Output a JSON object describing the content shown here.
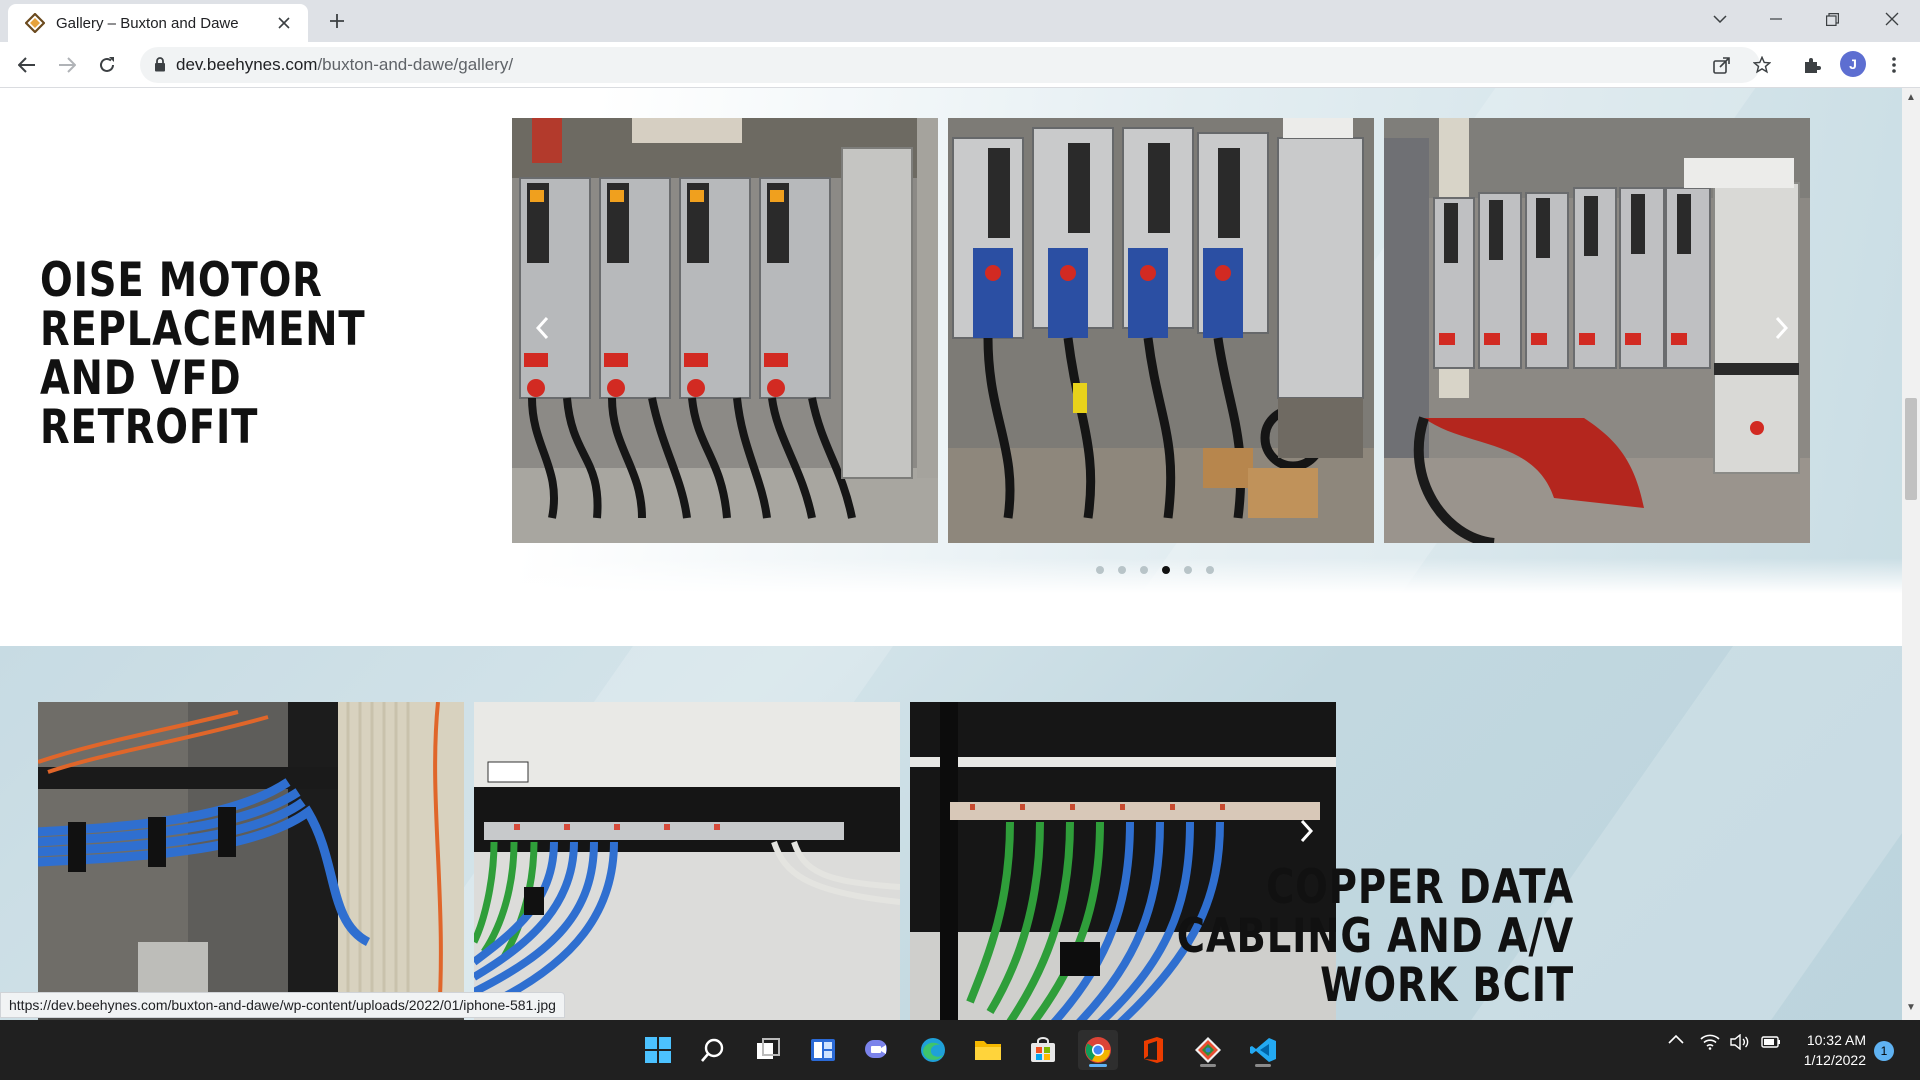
{
  "browser": {
    "tab_title": "Gallery – Buxton and Dawe",
    "url_domain": "dev.beehynes.com",
    "url_path": "/buxton-and-dawe/gallery/",
    "profile_initial": "J",
    "status_url": "https://dev.beehynes.com/buxton-and-dawe/wp-content/uploads/2022/01/iphone-581.jpg"
  },
  "page": {
    "section1": {
      "heading": "OISE MOTOR REPLACEMENT AND VFD RETROFIT",
      "carousel": {
        "dot_count": 6,
        "active_dot": 4
      }
    },
    "section2": {
      "heading": "COPPER DATA CABLING AND A/V WORK BCIT"
    }
  },
  "taskbar": {
    "icons": [
      "start-icon",
      "search-icon",
      "task-view-icon",
      "widgets-icon",
      "teams-chat-icon",
      "edge-icon",
      "file-explorer-icon",
      "store-icon",
      "chrome-icon",
      "office-icon",
      "git-icon",
      "vscode-icon"
    ],
    "clock_time": "10:32 AM",
    "clock_date": "1/12/2022",
    "notification_count": "1"
  },
  "colors": {
    "heading": "#111111",
    "tabstrip": "#dee1e6",
    "taskbar": "#202020",
    "accent": "#5fb2f2"
  }
}
